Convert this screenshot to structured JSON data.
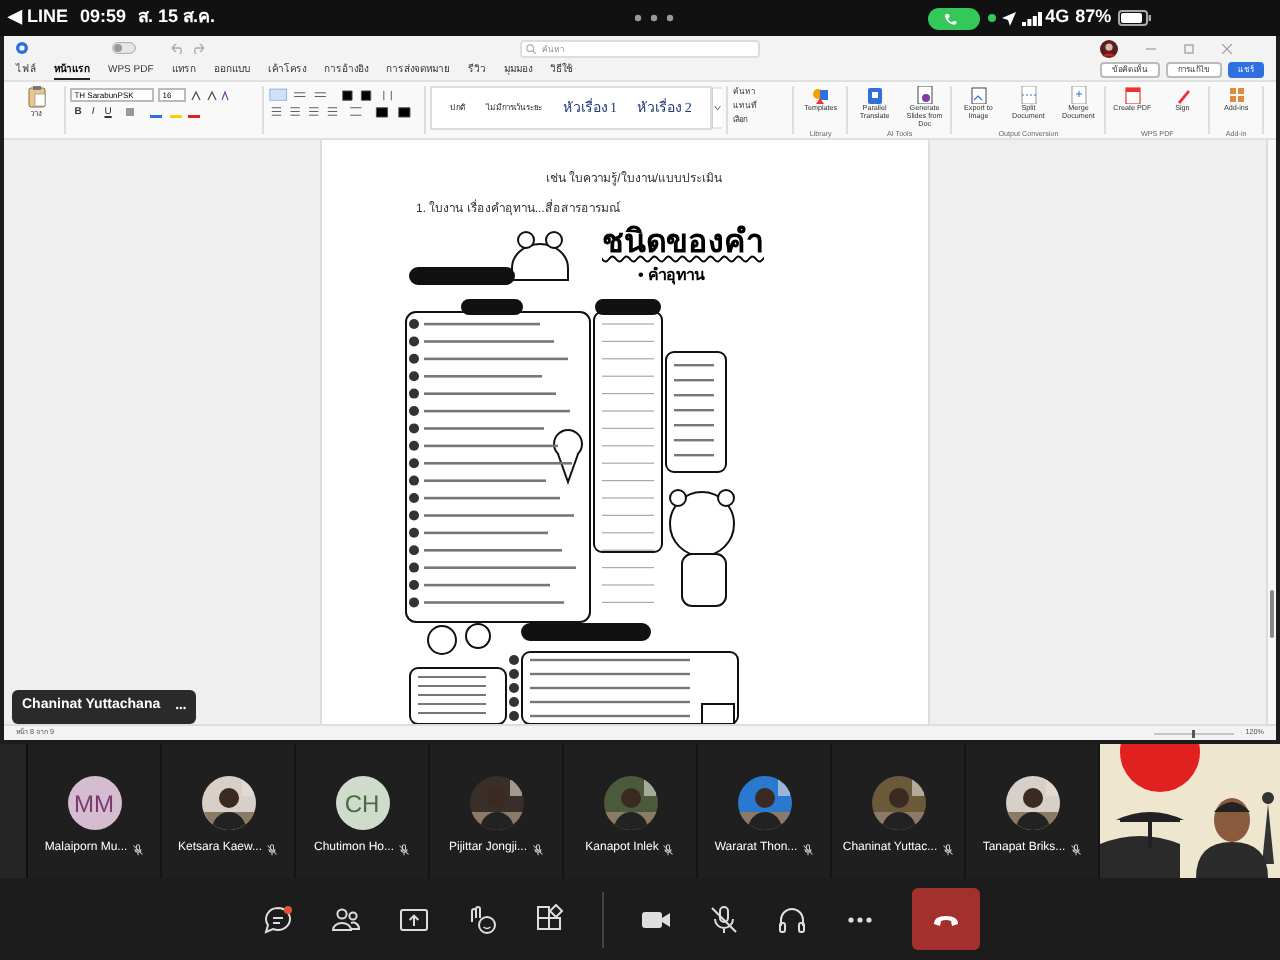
{
  "phone_status": {
    "back_app": "◀ LINE",
    "time": "09:59",
    "date": "ส. 15 ส.ค.",
    "network": "4G",
    "battery": "87%"
  },
  "app_window": {
    "search_placeholder": "ค้นหา",
    "autosave_on": false,
    "tabs": [
      {
        "label": "ไฟล์",
        "selected": false
      },
      {
        "label": "หน้าแรก",
        "selected": true
      },
      {
        "label": "WPS PDF",
        "selected": false
      },
      {
        "label": "แทรก",
        "selected": false
      },
      {
        "label": "ออกแบบ",
        "selected": false
      },
      {
        "label": "เค้าโครง",
        "selected": false
      },
      {
        "label": "การอ้างอิง",
        "selected": false
      },
      {
        "label": "การส่งจดหมาย",
        "selected": false
      },
      {
        "label": "รีวิว",
        "selected": false
      },
      {
        "label": "มุมมอง",
        "selected": false
      },
      {
        "label": "วิธีใช้",
        "selected": false
      }
    ],
    "right_buttons": [
      {
        "label": "ข้อคิดเห็น",
        "kind": "plain"
      },
      {
        "label": "การแก้ไข",
        "kind": "plain"
      },
      {
        "label": "แชร์",
        "kind": "primary"
      }
    ],
    "paste_label": "วาง",
    "font_name": "TH SarabunPSK",
    "font_size": "16",
    "format_buttons": [
      "B",
      "I",
      "U"
    ],
    "styles": [
      "ปกติ",
      "ไม่มีการเว้นระยะ",
      "หัวเรื่อง 1",
      "หัวเรื่อง 2"
    ],
    "find_items": [
      "ค้นหา",
      "แทนที่",
      "เลือก"
    ],
    "tool_groups": [
      {
        "label": "Library",
        "tools": [
          "Templates"
        ]
      },
      {
        "label": "AI Tools",
        "tools": [
          "Parallel Translate",
          "Generate Slides from Doc"
        ]
      },
      {
        "label": "Output Conversion",
        "tools": [
          "Export to Image",
          "Split Document",
          "Merge Document"
        ]
      },
      {
        "label": "WPS PDF",
        "tools": [
          "Create PDF",
          "Sign"
        ]
      },
      {
        "label": "Add-in",
        "tools": [
          "Add-ins"
        ]
      }
    ],
    "document": {
      "lines": [
        "เช่น ใบความรู้/ใบงาน/แบบประเมิน",
        "1. ใบงาน เรื่องคำอุทาน...สื่อสารอารมณ์"
      ],
      "worksheet_title": "ชนิดของคำ",
      "worksheet_subtitle": "• คำอุทาน"
    },
    "status_bar": {
      "page": "หน้า 8 จาก 9",
      "zoom": "120%"
    }
  },
  "presenter_label": "Chaninat Yuttachana",
  "participants": [
    {
      "name": "Malaiporn Mu...",
      "kind": "initials",
      "initials": "MM",
      "muted": true
    },
    {
      "name": "Ketsara Kaew...",
      "muted": true
    },
    {
      "name": "Chutimon Ho...",
      "kind": "initials",
      "initials": "CH",
      "muted": true
    },
    {
      "name": "Pijittar Jongji...",
      "muted": true
    },
    {
      "name": "Kanapot Inlek",
      "muted": true
    },
    {
      "name": "Wararat Thon...",
      "muted": true
    },
    {
      "name": "Chaninat Yuttac...",
      "muted": true
    },
    {
      "name": "Tanapat Briks...",
      "muted": true
    }
  ],
  "controls": [
    {
      "kind": "chat",
      "unread": true
    },
    {
      "kind": "people"
    },
    {
      "kind": "share"
    },
    {
      "kind": "reactions"
    },
    {
      "kind": "apps"
    },
    {
      "kind": "camera"
    },
    {
      "kind": "mic",
      "muted": true
    },
    {
      "kind": "audio"
    },
    {
      "kind": "more"
    },
    {
      "kind": "leave"
    }
  ]
}
